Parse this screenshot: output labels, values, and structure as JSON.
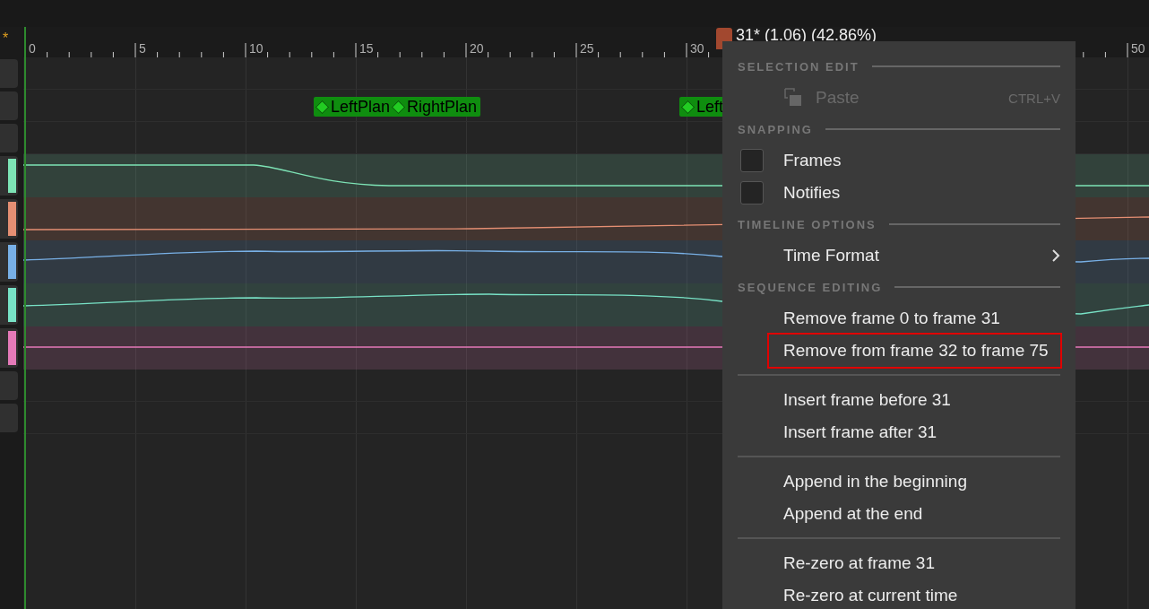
{
  "header": {
    "marker": "*"
  },
  "ruler": {
    "labels": [
      "0",
      "5",
      "10",
      "15",
      "20",
      "25",
      "30",
      "50"
    ]
  },
  "scrubber": {
    "label": "31* (1.06) (42.86%)"
  },
  "notifies": [
    {
      "label": "LeftPlan"
    },
    {
      "label": "RightPlan"
    },
    {
      "label": "Left"
    }
  ],
  "tracks": [
    {
      "kind": "empty"
    },
    {
      "kind": "notify"
    },
    {
      "kind": "empty"
    },
    {
      "kind": "curve",
      "color": "#7de3b5"
    },
    {
      "kind": "curve",
      "color": "#e58f73"
    },
    {
      "kind": "curve",
      "color": "#78b0e6"
    },
    {
      "kind": "curve",
      "color": "#78e2c6"
    },
    {
      "kind": "curve",
      "color": "#e47ab8"
    },
    {
      "kind": "empty"
    },
    {
      "kind": "empty"
    }
  ],
  "context_menu": {
    "sections": [
      {
        "title": "SELECTION EDIT",
        "items": [
          {
            "kind": "action",
            "label": "Paste",
            "shortcut": "CTRL+V",
            "disabled": true,
            "highlighted": false
          }
        ]
      },
      {
        "title": "SNAPPING",
        "items": [
          {
            "kind": "checkbox",
            "label": "Frames",
            "checked": false
          },
          {
            "kind": "checkbox",
            "label": "Notifies",
            "checked": false
          }
        ]
      },
      {
        "title": "TIMELINE OPTIONS",
        "items": [
          {
            "kind": "submenu",
            "label": "Time Format"
          }
        ]
      },
      {
        "title": "SEQUENCE EDITING",
        "items": [
          {
            "kind": "action",
            "label": "Remove frame 0 to frame 31",
            "disabled": false,
            "highlighted": false
          },
          {
            "kind": "action",
            "label": "Remove from frame 32 to frame 75",
            "disabled": false,
            "highlighted": true
          },
          {
            "kind": "separator"
          },
          {
            "kind": "action",
            "label": "Insert frame before 31",
            "disabled": false,
            "highlighted": false
          },
          {
            "kind": "action",
            "label": "Insert frame after 31",
            "disabled": false,
            "highlighted": false
          },
          {
            "kind": "separator"
          },
          {
            "kind": "action",
            "label": "Append in the beginning",
            "disabled": false,
            "highlighted": false
          },
          {
            "kind": "action",
            "label": "Append at the end",
            "disabled": false,
            "highlighted": false
          },
          {
            "kind": "separator"
          },
          {
            "kind": "action",
            "label": "Re-zero at frame 31",
            "disabled": false,
            "highlighted": false
          },
          {
            "kind": "action",
            "label": "Re-zero at current time",
            "disabled": false,
            "highlighted": false
          }
        ]
      }
    ]
  }
}
